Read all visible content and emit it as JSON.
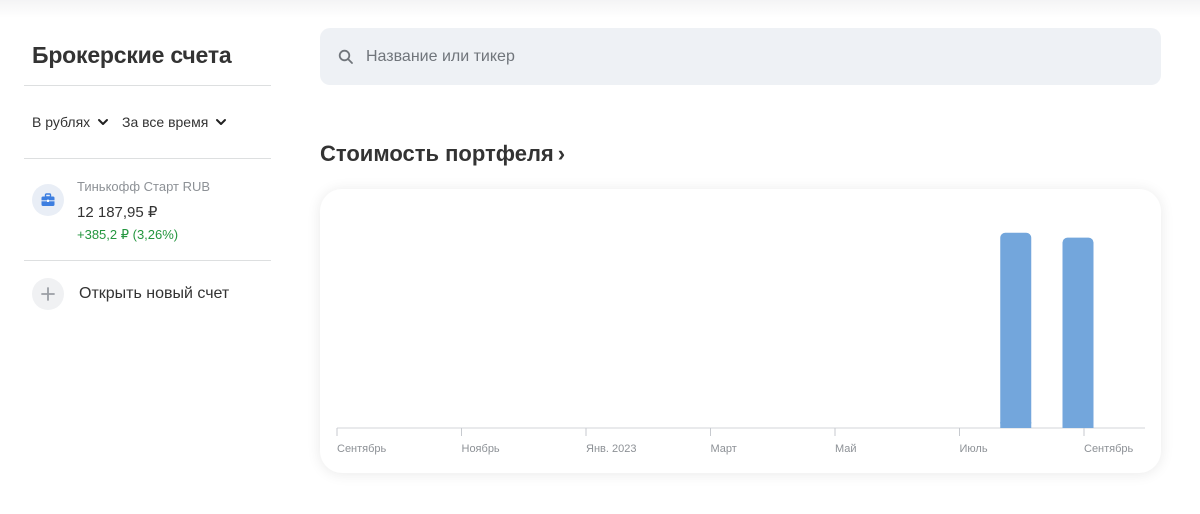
{
  "sidebar": {
    "title": "Брокерские счета",
    "filters": {
      "currency": "В рублях",
      "period": "За все время"
    },
    "accounts": [
      {
        "name": "Тинькофф Старт RUB",
        "value": "12 187,95 ₽",
        "change": "+385,2 ₽ (3,26%)",
        "icon": "briefcase-icon"
      }
    ],
    "open_account_label": "Открыть новый счет"
  },
  "search": {
    "placeholder": "Название или тикер",
    "value": ""
  },
  "portfolio": {
    "title": "Стоимость портфеля",
    "chevron": "›"
  },
  "colors": {
    "bar": "#73a6dc",
    "gain": "#24963f",
    "search_bg": "#eef1f5"
  },
  "chart_data": {
    "type": "bar",
    "x_tick_labels": [
      "Сентябрь",
      "Ноябрь",
      "Янв. 2023",
      "Март",
      "Май",
      "Июль",
      "Сентябрь"
    ],
    "bars": [
      {
        "month_index": 11,
        "value": 1.0
      },
      {
        "month_index": 12,
        "value": 0.975
      }
    ],
    "ylim": [
      0,
      1.05
    ],
    "grid": false
  }
}
